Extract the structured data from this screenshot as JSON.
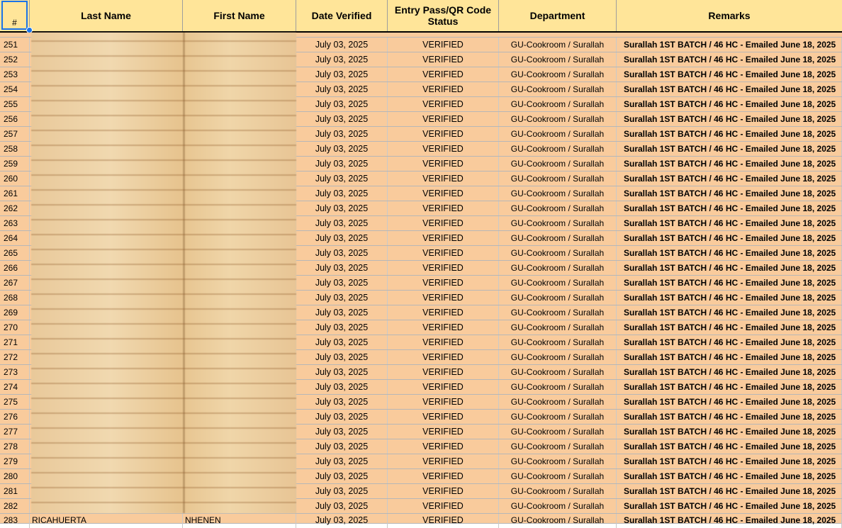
{
  "sheet": {
    "headers": {
      "num": "#",
      "last_name": "Last Name",
      "first_name": "First Name",
      "date_verified": "Date Verified",
      "status": "Entry Pass/QR Code Status",
      "department": "Department",
      "remarks": "Remarks"
    },
    "colors": {
      "header_bg": "#ffe599",
      "row_bg": "#f9cb9c",
      "selection": "#1a73e8"
    },
    "rows": [
      {
        "num": "251",
        "date": "July 03, 2025",
        "status": "VERIFIED",
        "dept": "GU-Cookroom / Surallah",
        "remarks": "Surallah 1ST BATCH / 46 HC - Emailed June 18, 2025"
      },
      {
        "num": "252",
        "date": "July 03, 2025",
        "status": "VERIFIED",
        "dept": "GU-Cookroom / Surallah",
        "remarks": "Surallah 1ST BATCH / 46 HC - Emailed June 18, 2025"
      },
      {
        "num": "253",
        "date": "July 03, 2025",
        "status": "VERIFIED",
        "dept": "GU-Cookroom / Surallah",
        "remarks": "Surallah 1ST BATCH / 46 HC - Emailed June 18, 2025"
      },
      {
        "num": "254",
        "date": "July 03, 2025",
        "status": "VERIFIED",
        "dept": "GU-Cookroom / Surallah",
        "remarks": "Surallah 1ST BATCH / 46 HC - Emailed June 18, 2025"
      },
      {
        "num": "255",
        "date": "July 03, 2025",
        "status": "VERIFIED",
        "dept": "GU-Cookroom / Surallah",
        "remarks": "Surallah 1ST BATCH / 46 HC - Emailed June 18, 2025"
      },
      {
        "num": "256",
        "date": "July 03, 2025",
        "status": "VERIFIED",
        "dept": "GU-Cookroom / Surallah",
        "remarks": "Surallah 1ST BATCH / 46 HC - Emailed June 18, 2025"
      },
      {
        "num": "257",
        "date": "July 03, 2025",
        "status": "VERIFIED",
        "dept": "GU-Cookroom / Surallah",
        "remarks": "Surallah 1ST BATCH / 46 HC - Emailed June 18, 2025"
      },
      {
        "num": "258",
        "date": "July 03, 2025",
        "status": "VERIFIED",
        "dept": "GU-Cookroom / Surallah",
        "remarks": "Surallah 1ST BATCH / 46 HC - Emailed June 18, 2025"
      },
      {
        "num": "259",
        "date": "July 03, 2025",
        "status": "VERIFIED",
        "dept": "GU-Cookroom / Surallah",
        "remarks": "Surallah 1ST BATCH / 46 HC - Emailed June 18, 2025"
      },
      {
        "num": "260",
        "date": "July 03, 2025",
        "status": "VERIFIED",
        "dept": "GU-Cookroom / Surallah",
        "remarks": "Surallah 1ST BATCH / 46 HC - Emailed June 18, 2025"
      },
      {
        "num": "261",
        "date": "July 03, 2025",
        "status": "VERIFIED",
        "dept": "GU-Cookroom / Surallah",
        "remarks": "Surallah 1ST BATCH / 46 HC - Emailed June 18, 2025"
      },
      {
        "num": "262",
        "date": "July 03, 2025",
        "status": "VERIFIED",
        "dept": "GU-Cookroom / Surallah",
        "remarks": "Surallah 1ST BATCH / 46 HC - Emailed June 18, 2025"
      },
      {
        "num": "263",
        "date": "July 03, 2025",
        "status": "VERIFIED",
        "dept": "GU-Cookroom / Surallah",
        "remarks": "Surallah 1ST BATCH / 46 HC - Emailed June 18, 2025"
      },
      {
        "num": "264",
        "date": "July 03, 2025",
        "status": "VERIFIED",
        "dept": "GU-Cookroom / Surallah",
        "remarks": "Surallah 1ST BATCH / 46 HC - Emailed June 18, 2025"
      },
      {
        "num": "265",
        "date": "July 03, 2025",
        "status": "VERIFIED",
        "dept": "GU-Cookroom / Surallah",
        "remarks": "Surallah 1ST BATCH / 46 HC - Emailed June 18, 2025"
      },
      {
        "num": "266",
        "date": "July 03, 2025",
        "status": "VERIFIED",
        "dept": "GU-Cookroom / Surallah",
        "remarks": "Surallah 1ST BATCH / 46 HC - Emailed June 18, 2025"
      },
      {
        "num": "267",
        "date": "July 03, 2025",
        "status": "VERIFIED",
        "dept": "GU-Cookroom / Surallah",
        "remarks": "Surallah 1ST BATCH / 46 HC - Emailed June 18, 2025"
      },
      {
        "num": "268",
        "date": "July 03, 2025",
        "status": "VERIFIED",
        "dept": "GU-Cookroom / Surallah",
        "remarks": "Surallah 1ST BATCH / 46 HC - Emailed June 18, 2025"
      },
      {
        "num": "269",
        "date": "July 03, 2025",
        "status": "VERIFIED",
        "dept": "GU-Cookroom / Surallah",
        "remarks": "Surallah 1ST BATCH / 46 HC - Emailed June 18, 2025"
      },
      {
        "num": "270",
        "date": "July 03, 2025",
        "status": "VERIFIED",
        "dept": "GU-Cookroom / Surallah",
        "remarks": "Surallah 1ST BATCH / 46 HC - Emailed June 18, 2025"
      },
      {
        "num": "271",
        "date": "July 03, 2025",
        "status": "VERIFIED",
        "dept": "GU-Cookroom / Surallah",
        "remarks": "Surallah 1ST BATCH / 46 HC - Emailed June 18, 2025"
      },
      {
        "num": "272",
        "date": "July 03, 2025",
        "status": "VERIFIED",
        "dept": "GU-Cookroom / Surallah",
        "remarks": "Surallah 1ST BATCH / 46 HC - Emailed June 18, 2025"
      },
      {
        "num": "273",
        "date": "July 03, 2025",
        "status": "VERIFIED",
        "dept": "GU-Cookroom / Surallah",
        "remarks": "Surallah 1ST BATCH / 46 HC - Emailed June 18, 2025"
      },
      {
        "num": "274",
        "date": "July 03, 2025",
        "status": "VERIFIED",
        "dept": "GU-Cookroom / Surallah",
        "remarks": "Surallah 1ST BATCH / 46 HC - Emailed June 18, 2025"
      },
      {
        "num": "275",
        "date": "July 03, 2025",
        "status": "VERIFIED",
        "dept": "GU-Cookroom / Surallah",
        "remarks": "Surallah 1ST BATCH / 46 HC - Emailed June 18, 2025"
      },
      {
        "num": "276",
        "date": "July 03, 2025",
        "status": "VERIFIED",
        "dept": "GU-Cookroom / Surallah",
        "remarks": "Surallah 1ST BATCH / 46 HC - Emailed June 18, 2025"
      },
      {
        "num": "277",
        "date": "July 03, 2025",
        "status": "VERIFIED",
        "dept": "GU-Cookroom / Surallah",
        "remarks": "Surallah 1ST BATCH / 46 HC - Emailed June 18, 2025"
      },
      {
        "num": "278",
        "date": "July 03, 2025",
        "status": "VERIFIED",
        "dept": "GU-Cookroom / Surallah",
        "remarks": "Surallah 1ST BATCH / 46 HC - Emailed June 18, 2025"
      },
      {
        "num": "279",
        "date": "July 03, 2025",
        "status": "VERIFIED",
        "dept": "GU-Cookroom / Surallah",
        "remarks": "Surallah 1ST BATCH / 46 HC - Emailed June 18, 2025"
      },
      {
        "num": "280",
        "date": "July 03, 2025",
        "status": "VERIFIED",
        "dept": "GU-Cookroom / Surallah",
        "remarks": "Surallah 1ST BATCH / 46 HC - Emailed June 18, 2025"
      },
      {
        "num": "281",
        "date": "July 03, 2025",
        "status": "VERIFIED",
        "dept": "GU-Cookroom / Surallah",
        "remarks": "Surallah 1ST BATCH / 46 HC - Emailed June 18, 2025"
      },
      {
        "num": "282",
        "date": "July 03, 2025",
        "status": "VERIFIED",
        "dept": "GU-Cookroom / Surallah",
        "remarks": "Surallah 1ST BATCH / 46 HC - Emailed June 18, 2025"
      }
    ],
    "last_row": {
      "num": "283",
      "last_name": "RICAHUERTA",
      "first_name": "NHENEN",
      "date": "July 03, 2025",
      "status": "VERIFIED",
      "dept": "GU-Cookroom / Surallah",
      "remarks": "Surallah 1ST BATCH / 46 HC - Emailed June 18, 2025"
    }
  }
}
